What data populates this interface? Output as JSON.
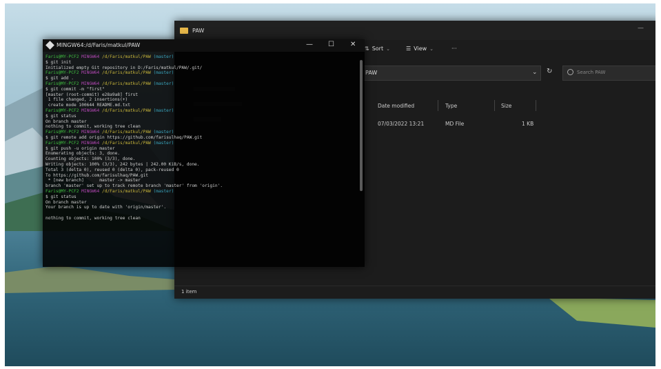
{
  "explorer": {
    "title": "PAW",
    "toolbar": {
      "sort_label": "Sort",
      "view_label": "View",
      "more_label": "···"
    },
    "address": "PAW",
    "search_placeholder": "Search PAW",
    "columns": [
      "Date modified",
      "Type",
      "Size"
    ],
    "rows": [
      {
        "date": "07/03/2022 13:21",
        "type": "MD File",
        "size": "1 KB"
      }
    ],
    "status": "1 item"
  },
  "terminal": {
    "title": "MINGW64:/d/Faris/matkul/PAW",
    "prompt": {
      "user": "Faris@MY-PCF2",
      "host": "MINGW64",
      "path": "/d/Faris/matkul/PAW",
      "branch": "(master)"
    },
    "blocks": [
      {
        "command": "$ git init",
        "output": [
          "Initialized empty Git repository in D:/Faris/matkul/PAW/.git/"
        ]
      },
      {
        "command": "$ git add .",
        "output": []
      },
      {
        "command": "$ git commit -m \"first\"",
        "output": [
          "[master (root-commit) e28a9a8] first",
          " 1 file changed, 2 insertions(+)",
          " create mode 100644 README.md.txt"
        ]
      },
      {
        "command": "$ git status",
        "output": [
          "On branch master",
          "nothing to commit, working tree clean"
        ]
      },
      {
        "command": "$ git remote add origin https://github.com/farisulhaq/PAW.git",
        "output": []
      },
      {
        "command": "$ git push -u origin master",
        "output": [
          "Enumerating objects: 3, done.",
          "Counting objects: 100% (3/3), done.",
          "Writing objects: 100% (3/3), 242 bytes | 242.00 KiB/s, done.",
          "Total 3 (delta 0), reused 0 (delta 0), pack-reused 0",
          "To https://github.com/farisulhaq/PAW.git",
          " * [new branch]      master -> master",
          "branch 'master' set up to track remote branch 'master' from 'origin'."
        ]
      },
      {
        "command": "$ git status",
        "output": [
          "On branch master",
          "Your branch is up to date with 'origin/master'.",
          "",
          "nothing to commit, working tree clean"
        ]
      }
    ]
  },
  "colors": {
    "terminal_user": "#3fbd3f",
    "terminal_host": "#b548b5",
    "terminal_path": "#c7b53b",
    "terminal_branch": "#3aa8c1",
    "folder": "#e8b84a"
  }
}
